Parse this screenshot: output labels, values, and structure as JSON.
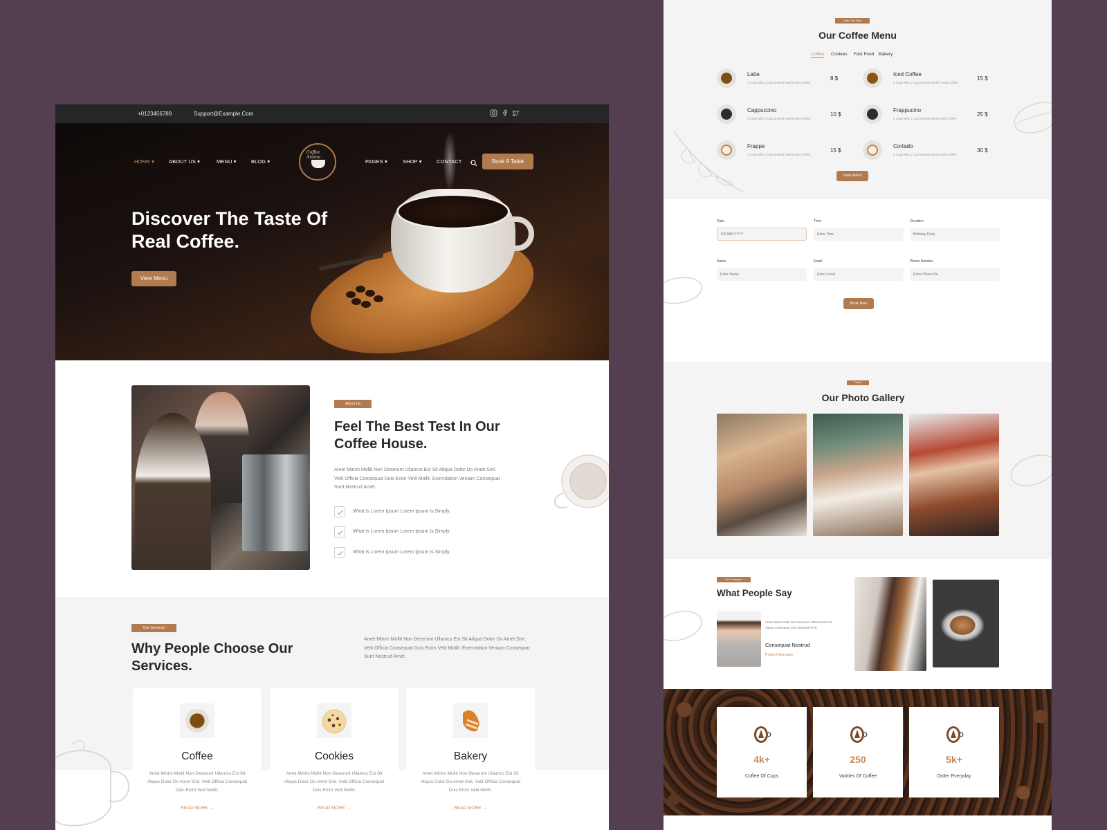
{
  "topbar": {
    "phone": "+0123456789",
    "email": "Support@Example.Com",
    "social_icons": [
      "instagram-icon",
      "facebook-icon",
      "twitter-icon"
    ]
  },
  "nav": {
    "left_items": [
      {
        "label": "HOME ▾",
        "active": true
      },
      {
        "label": "ABOUT US ▾",
        "active": false
      },
      {
        "label": "MENU ▾",
        "active": false
      },
      {
        "label": "BLOG ▾",
        "active": false
      }
    ],
    "right_items": [
      {
        "label": "PAGES ▾"
      },
      {
        "label": "SHOP ▾"
      },
      {
        "label": "CONTACT"
      }
    ],
    "logo_text": "Coffee Aroma",
    "book_button": "Book A Table"
  },
  "hero": {
    "title": "Discover The Taste Of Real Coffee.",
    "button": "View Menu"
  },
  "about": {
    "badge": "About Us",
    "title": "Feel The Best Test In Our Coffee House.",
    "text": "Amet Minim Mollit Non Deserunt Ullamco Est Sit Aliqua Dolor Do Amet Sint. Velit Officia Consequat Duis Enim Velit Mollit. Exercitation Veniam Consequat Sunt Nostrud Amet.",
    "checklist": [
      "What Is Lorem Ipsum Lorem Ipsum Is Simply.",
      "What Is Lorem Ipsum Lorem Ipsum Is Simply.",
      "What Is Lorem Ipsum Lorem Ipsum Is Simply."
    ]
  },
  "services": {
    "badge": "Our Services",
    "title": "Why People Choose Our Services.",
    "text": "Amet Minim Mollit Non Deserunt Ullamco Est Sit Aliqua Dolor Do Amet Sint. Velit Officia Consequat Duis Enim Velit Mollit. Exercitation Veniam Consequat Sunt Nostrud Amet.",
    "cards": [
      {
        "title": "Coffee",
        "icon": "coffee-cup-icon",
        "text": "Amet Minim Mollit Non Deserunt Ullamco Est Sit Aliqua Dolor Do Amet Sint. Velit Officia Consequat Duis Enim Velit Mollit.",
        "link": "READ MORE →"
      },
      {
        "title": "Cookies",
        "icon": "cookie-icon",
        "text": "Amet Minim Mollit Non Deserunt Ullamco Est Sit Aliqua Dolor Do Amet Sint. Velit Officia Consequat Duis Enim Velit Mollit.",
        "link": "READ MORE →"
      },
      {
        "title": "Bakery",
        "icon": "croissant-icon",
        "text": "Amet Minim Mollit Non Deserunt Ullamco Est Sit Aliqua Dolor Do Amet Sint. Velit Officia Consequat Duis Enim Velit Mollit.",
        "link": "READ MORE →"
      }
    ]
  },
  "menu": {
    "badge": "Taste The Best",
    "title": "Our Coffee Menu",
    "tabs": [
      {
        "label": "Coffee",
        "active": true
      },
      {
        "label": "Cookies",
        "active": false
      },
      {
        "label": "Fast Food",
        "active": false
      },
      {
        "label": "Bakery",
        "active": false
      }
    ],
    "items": [
      {
        "name": "Latte",
        "desc": "2 Cups Milk,1 Cup Brewed Dark Roast Coffee",
        "price": "8 $",
        "color": "#7f4c11"
      },
      {
        "name": "Iced Coffee",
        "desc": "2 Cups Milk,1 Cup Brewed Dark R Oast Coffee",
        "price": "15 $",
        "color": "#8a5511"
      },
      {
        "name": "Cappuccino",
        "desc": "2 Cups Milk,1 Cup Brewed Dark Roast Coffee",
        "price": "10 $",
        "color": "#2c2c30"
      },
      {
        "name": "Frappucino",
        "desc": "2 Cups Milk,1 Cup Brewed Dark Roast Coffee",
        "price": "25 $",
        "color": "#2c2c30"
      },
      {
        "name": "Frappe",
        "desc": "2 Cups Milk,1 Cup Brewed Dark Roast Coffee",
        "price": "15 $",
        "color": "#f4ede3"
      },
      {
        "name": "Cortado",
        "desc": "2 Cups Milk,1 Cup Brewed Dark Roast Coffee",
        "price": "30 $",
        "color": "#f4ede3"
      }
    ],
    "button": "View Menu"
  },
  "booking": {
    "fields": [
      {
        "label": "Date",
        "placeholder": "DD-MM-YYYY"
      },
      {
        "label": "Time",
        "placeholder": "Enter Time"
      },
      {
        "label": "Occation",
        "placeholder": "Birthday Party"
      },
      {
        "label": "Name",
        "placeholder": "Enter Name"
      },
      {
        "label": "Email",
        "placeholder": "Enter Email"
      },
      {
        "label": "Phone Number",
        "placeholder": "Enter Phone No."
      }
    ],
    "button": "Book Now"
  },
  "gallery": {
    "badge": "Photos",
    "title": "Our Photo Gallery"
  },
  "testimonial": {
    "badge": "Our Customer",
    "title": "What People Say",
    "quote": "Amet Minim Mollit Non Deserunt Ullamco Est Sit Aliqua Consequat Sunt Nostrud Amet.",
    "name": "Consequat  Nostrud",
    "role": "Project Manager"
  },
  "stats": [
    {
      "value": "4k+",
      "label": "Coffee Of Cups"
    },
    {
      "value": "250",
      "label": "Varities Of Coffee"
    },
    {
      "value": "5k+",
      "label": "Order Everyday"
    }
  ],
  "colors": {
    "accent": "#b27a4f",
    "accent_text": "#c58a59",
    "page_bg": "#533f4f",
    "section_gray": "#f4f4f4",
    "dark_topbar": "#262626"
  }
}
